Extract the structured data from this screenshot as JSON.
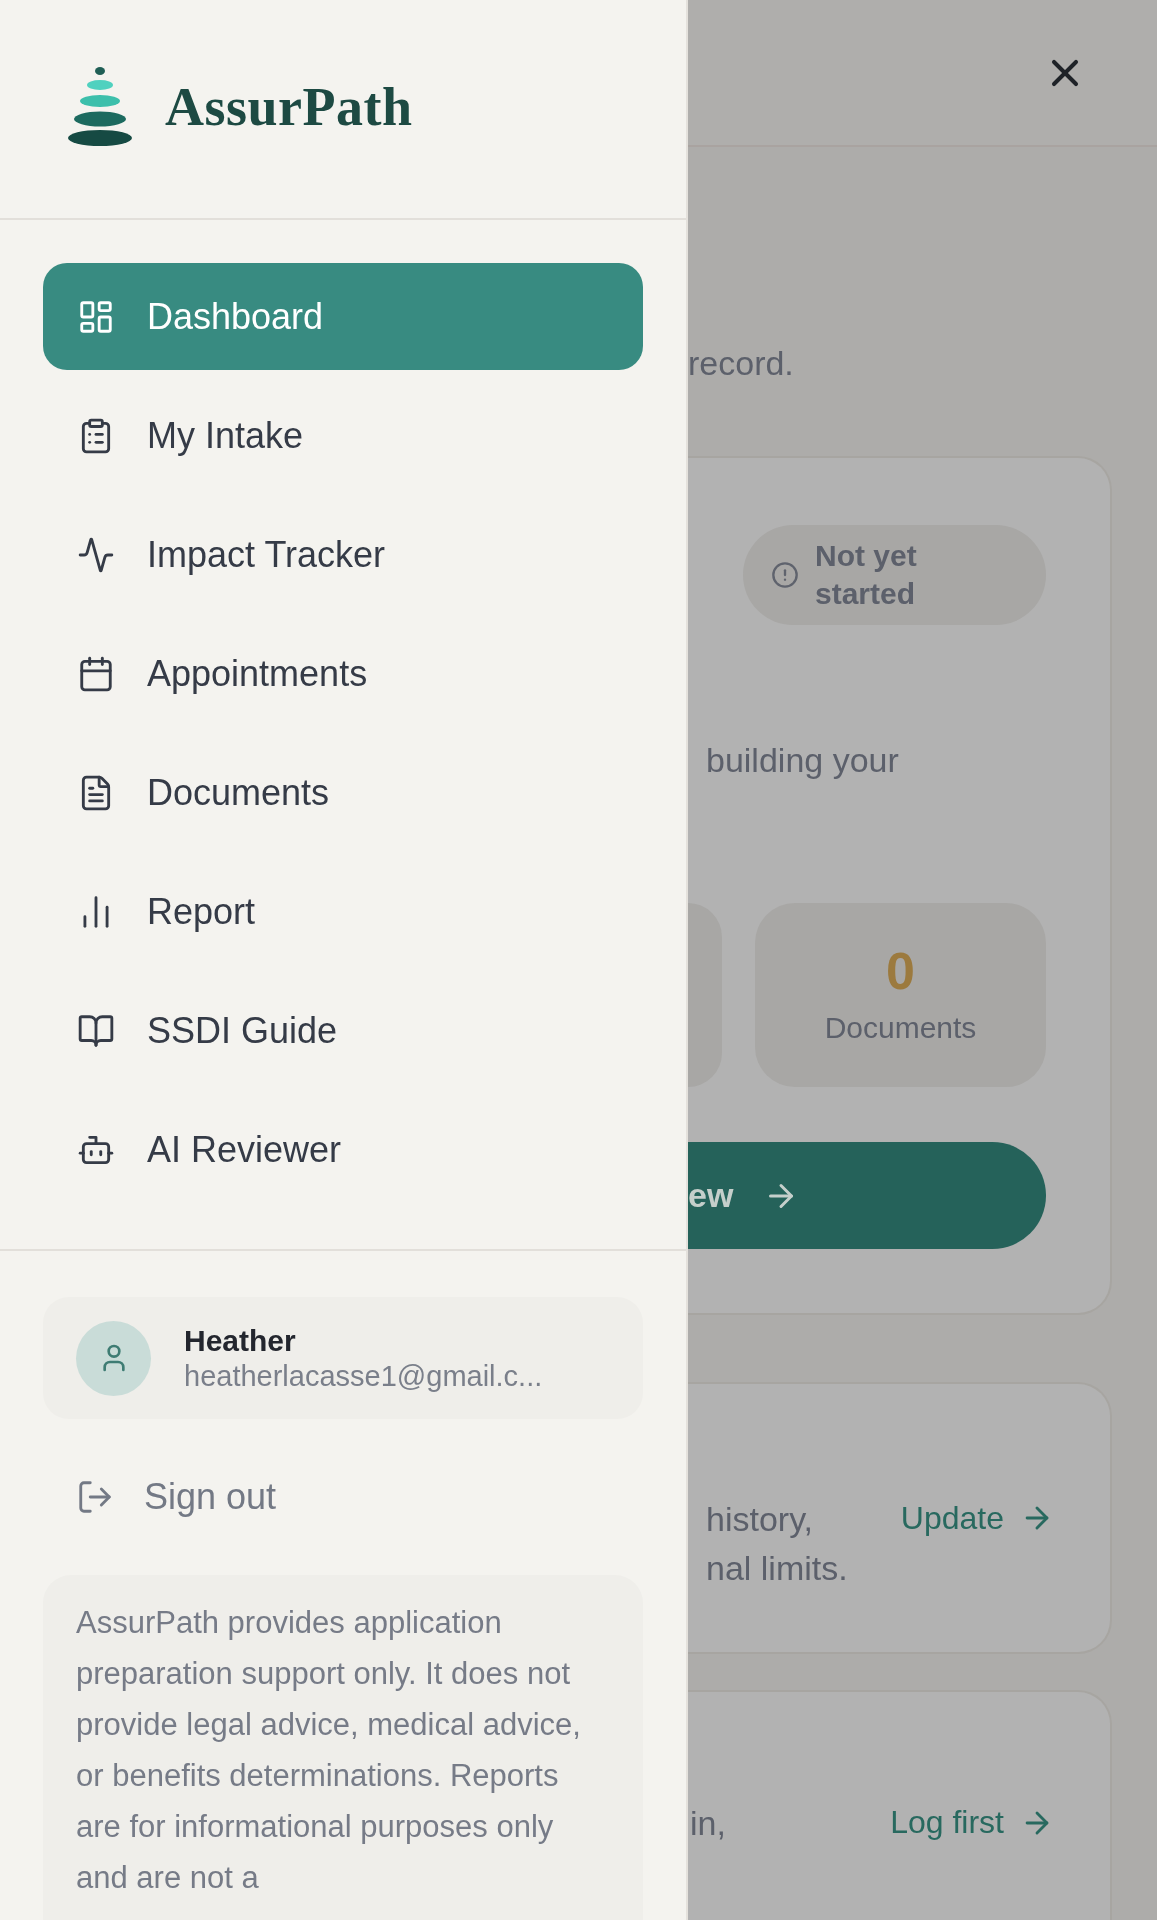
{
  "drawer": {
    "brand": "AssurPath",
    "nav": [
      {
        "label": "Dashboard",
        "selected": true
      },
      {
        "label": "My Intake",
        "selected": false
      },
      {
        "label": "Impact Tracker",
        "selected": false
      },
      {
        "label": "Appointments",
        "selected": false
      },
      {
        "label": "Documents",
        "selected": false
      },
      {
        "label": "Report",
        "selected": false
      },
      {
        "label": "SSDI Guide",
        "selected": false
      },
      {
        "label": "AI Reviewer",
        "selected": false
      }
    ],
    "user": {
      "name": "Heather",
      "email": "heatherlacasse1@gmail.c..."
    },
    "sign_out": "Sign out",
    "disclaimer": "AssurPath provides application preparation support only. It does not provide legal advice, medical advice, or benefits determinations. Reports are for informational purposes only and are not a"
  },
  "background": {
    "intro_fragment": "record.",
    "status_badge": "Not yet started",
    "description_fragment": "building your",
    "stat": {
      "value": "0",
      "label": "Documents"
    },
    "primary_button": "ew",
    "cards": [
      {
        "lines": [
          "history,",
          "nal limits."
        ],
        "action": "Update"
      },
      {
        "lines": [
          "in,"
        ],
        "action": "Log first"
      }
    ]
  }
}
